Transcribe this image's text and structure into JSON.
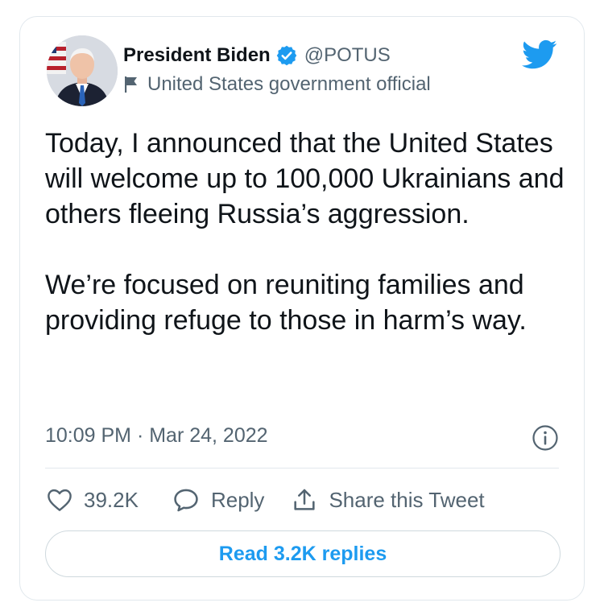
{
  "author": {
    "display_name": "President Biden",
    "handle": "@POTUS",
    "label": "United States government official",
    "verified": true
  },
  "tweet": {
    "paragraphs": [
      "Today, I announced that the United States will welcome up to 100,000 Ukrainians and others fleeing Russia’s aggression.",
      "We’re focused on reuniting families and providing refuge to those in harm’s way."
    ],
    "timestamp": "10:09 PM · Mar 24, 2022"
  },
  "actions": {
    "likes": "39.2K",
    "reply_label": "Reply",
    "share_label": "Share this Tweet"
  },
  "read_replies_label": "Read 3.2K replies",
  "icons": {
    "brand": "twitter-bird-icon",
    "verified": "verified-badge-icon",
    "label": "flag-icon",
    "info": "info-icon",
    "like": "heart-icon",
    "reply": "reply-bubble-icon",
    "share": "share-icon"
  },
  "colors": {
    "brand_blue": "#1d9bf0",
    "text_primary": "#0f1419",
    "text_secondary": "#536471",
    "border": "#e1e8ed"
  }
}
